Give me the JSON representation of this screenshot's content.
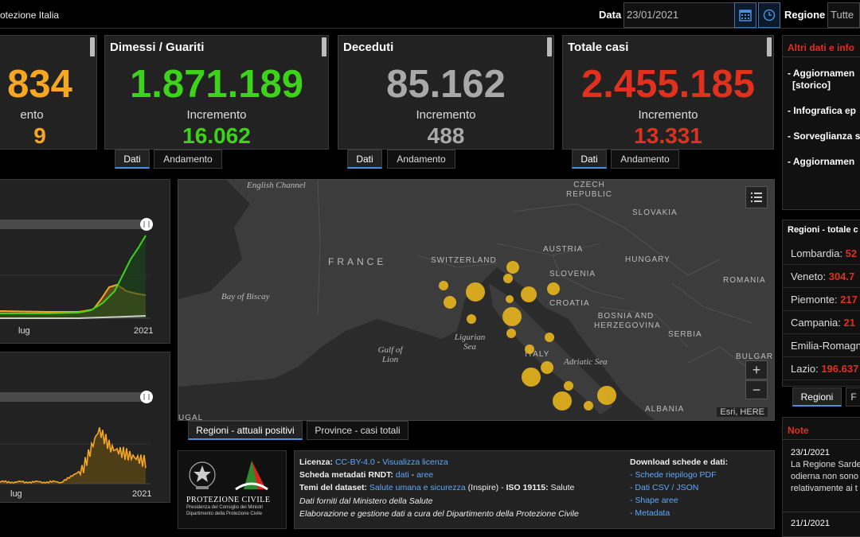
{
  "header": {
    "title": "otezione Italia",
    "data_label": "Data",
    "data_value": "23/01/2021",
    "regione_label": "Regione",
    "regione_value": "Tutte"
  },
  "cards": [
    {
      "title": "",
      "value": "834",
      "inc_label": "ento",
      "inc_value": "9",
      "color": "#f5a623"
    },
    {
      "title": "Dimessi / Guariti",
      "value": "1.871.189",
      "inc_label": "Incremento",
      "inc_value": "16.062",
      "color": "#3ed31b"
    },
    {
      "title": "Deceduti",
      "value": "85.162",
      "inc_label": "Incremento",
      "inc_value": "488",
      "color": "#a9a9a9"
    },
    {
      "title": "Totale casi",
      "value": "2.455.185",
      "inc_label": "Incremento",
      "inc_value": "13.331",
      "color": "#e0301e"
    }
  ],
  "card_tabs": {
    "dati": "Dati",
    "andamento": "Andamento"
  },
  "charts": {
    "top_x_labels": [
      "lug",
      "2021"
    ],
    "bottom_x_labels": [
      "lug",
      "2021"
    ]
  },
  "map": {
    "labels": {
      "english_channel": "English Channel",
      "czech": "CZECH REPUBLIC",
      "slovakia": "SLOVAKIA",
      "france": "FRANCE",
      "switzerland": "SWITZERLAND",
      "austria": "AUSTRIA",
      "hungary": "HUNGARY",
      "slovenia": "SLOVENIA",
      "romania": "ROMANIA",
      "croatia": "CROATIA",
      "bay_biscay": "Bay of Biscay",
      "bosnia": "BOSNIA AND HERZEGOVINA",
      "serbia": "SERBIA",
      "ligurian": "Ligurian Sea",
      "lion": "Gulf of Lion",
      "italy": "ITALY",
      "adriatic": "Adriatic Sea",
      "bulgaria": "BULGARI",
      "albania": "ALBANIA",
      "spain_partial": "UGAL"
    },
    "attribution": "Esri, HERE",
    "zoom_in": "+",
    "zoom_out": "−",
    "tabs": [
      "Regioni - attuali positivi",
      "Province - casi totali"
    ]
  },
  "right": {
    "header": "Altri dati e info",
    "links": [
      "- Aggiornamen",
      "[storico]",
      "- Infografica ep",
      "- Sorveglianza s",
      "- Aggiornamen"
    ],
    "regions_title": "Regioni - totale c",
    "regions": [
      {
        "name": "Lombardia: ",
        "value": "52"
      },
      {
        "name": "Veneto: ",
        "value": "304.7"
      },
      {
        "name": "Piemonte: ",
        "value": "217"
      },
      {
        "name": "Campania: ",
        "value": "21"
      },
      {
        "name": "Emilia-Romagn",
        "value": ""
      },
      {
        "name": "Lazio: ",
        "value": "196.637"
      }
    ],
    "region_tabs": [
      "Regioni",
      "F"
    ],
    "note_title": "Note",
    "notes": [
      {
        "date": "23/1/2021",
        "text1": "La Regione Sarde",
        "text2": "odierna non sono",
        "text3": "relativamente ai t"
      },
      {
        "date": "21/1/2021"
      }
    ]
  },
  "logo": {
    "name": "PROTEZIONE CIVILE",
    "sub1": "Presidenza del Consiglio dei Ministri",
    "sub2": "Dipartimento della Protezione Civile"
  },
  "license": {
    "l1_label": "Licenza:",
    "l1_link1": "CC-BY-4.0",
    "l1_sep": " - ",
    "l1_link2": "Visualizza licenza",
    "l2_label": "Scheda metadati RNDT:",
    "l2_link1": "dati",
    "l2_sep": " - ",
    "l2_link2": "aree",
    "l3_label": "Temi del dataset:",
    "l3_link": "Salute umana e sicurezza",
    "l3_text": " (Inspire) - ",
    "l3_label2": "ISO 19115:",
    "l3_text2": " Salute",
    "l4": "Dati forniti dal Ministero della Salute",
    "l5": "Elaborazione e gestione dati a cura del Dipartimento della Protezione Civile",
    "dl_title": "Download schede e dati:",
    "dl_links": [
      "- Schede riepilogo PDF",
      "- Dati CSV / JSON",
      "- Shape aree",
      "- Metadata"
    ]
  }
}
